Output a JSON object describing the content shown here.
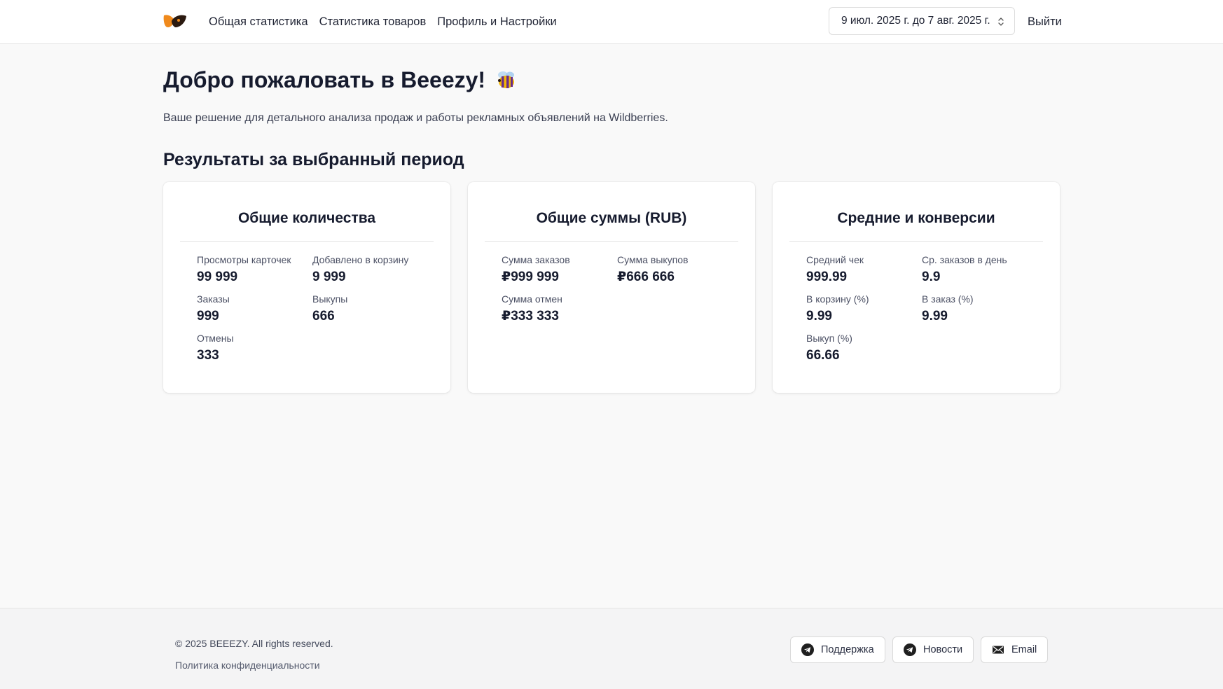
{
  "header": {
    "nav": [
      "Общая статистика",
      "Статистика товаров",
      "Профиль и Настройки"
    ],
    "date_range": "9 июл. 2025 г. до 7 авг. 2025 г.",
    "logout": "Выйти"
  },
  "main": {
    "title": "Добро пожаловать в Beeezy!",
    "subtitle": "Ваше решение для детального анализа продаж и работы рекламных объявлений на Wildberries.",
    "section_title": "Результаты за выбранный период",
    "cards": [
      {
        "title": "Общие количества",
        "metrics": [
          {
            "label": "Просмотры карточек",
            "value": "99 999"
          },
          {
            "label": "Добавлено в корзину",
            "value": "9 999"
          },
          {
            "label": "Заказы",
            "value": "999"
          },
          {
            "label": "Выкупы",
            "value": "666"
          },
          {
            "label": "Отмены",
            "value": "333"
          }
        ]
      },
      {
        "title": "Общие суммы (RUB)",
        "metrics": [
          {
            "label": "Сумма заказов",
            "value": "₽999 999"
          },
          {
            "label": "Сумма выкупов",
            "value": "₽666 666"
          },
          {
            "label": "Сумма отмен",
            "value": "₽333 333"
          }
        ]
      },
      {
        "title": "Средние и конверсии",
        "metrics": [
          {
            "label": "Средний чек",
            "value": "999.99"
          },
          {
            "label": "Ср. заказов в день",
            "value": "9.9"
          },
          {
            "label": "В корзину (%)",
            "value": "9.99"
          },
          {
            "label": "В заказ (%)",
            "value": "9.99"
          },
          {
            "label": "Выкуп (%)",
            "value": "66.66"
          }
        ]
      }
    ]
  },
  "footer": {
    "copyright": "© 2025 BEEEZY. All rights reserved.",
    "privacy": "Политика конфиденциальности",
    "buttons": [
      {
        "label": "Поддержка",
        "icon": "telegram-icon"
      },
      {
        "label": "Новости",
        "icon": "telegram-icon"
      },
      {
        "label": "Email",
        "icon": "mail-icon"
      }
    ]
  },
  "colors": {
    "logo_orange": "#f08a1c",
    "logo_dark": "#2b1a10",
    "text_primary": "#161b2e",
    "background": "#f9f9f9"
  }
}
